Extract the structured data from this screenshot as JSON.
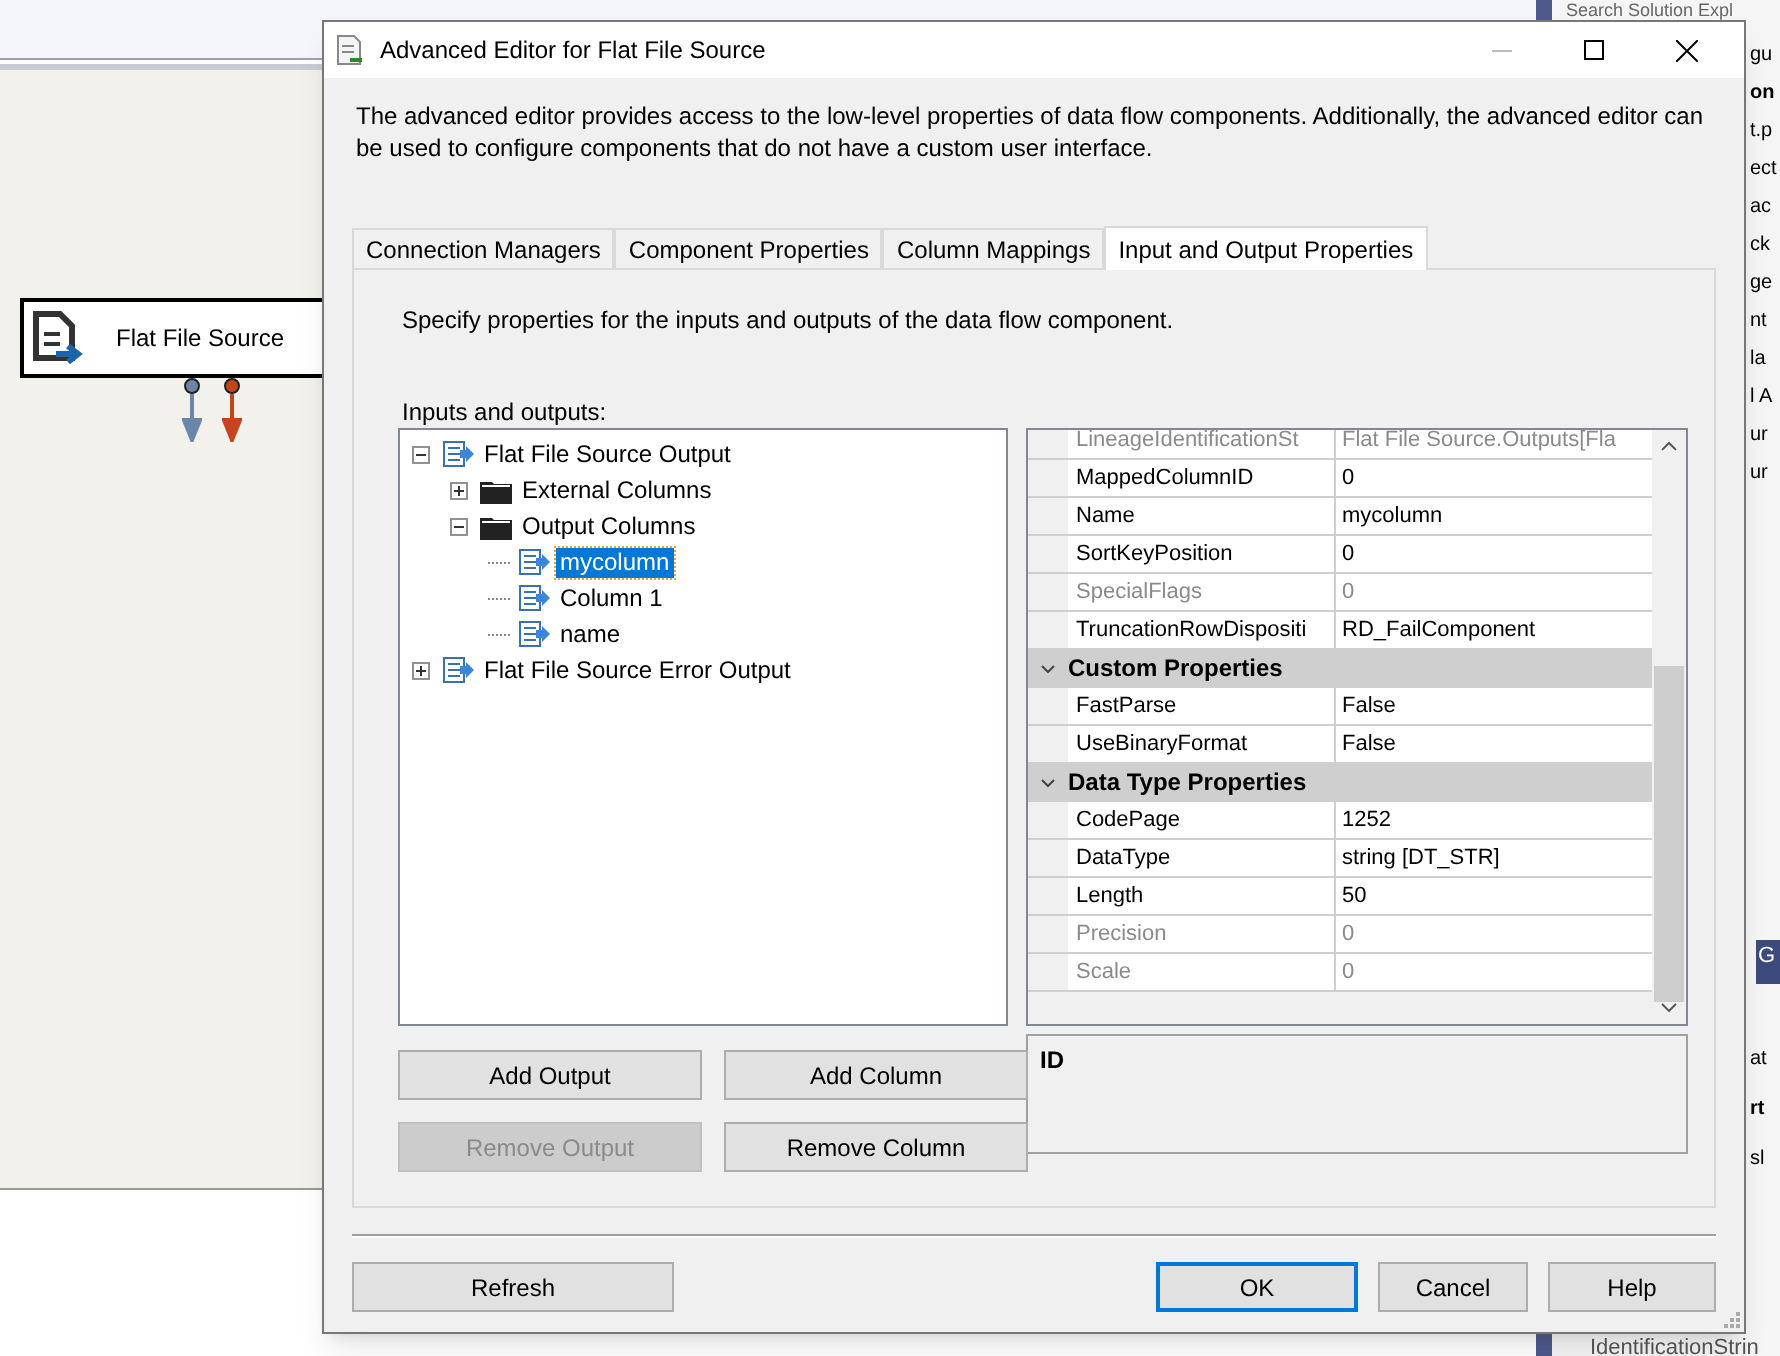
{
  "background": {
    "canvas_component": {
      "label": "Flat File Source"
    },
    "side_panel": {
      "search_text": "Search Solution Expl",
      "fragments": [
        {
          "text": "gu",
          "bold": false
        },
        {
          "text": "on",
          "bold": true
        },
        {
          "text": "t.p",
          "bold": false
        },
        {
          "text": "ect",
          "bold": false
        },
        {
          "text": "ac",
          "bold": false
        },
        {
          "text": "ck",
          "bold": false
        },
        {
          "text": "ge",
          "bold": false
        },
        {
          "text": "nt",
          "bold": false
        },
        {
          "text": "la",
          "bold": false
        },
        {
          "text": "l A",
          "bold": false
        },
        {
          "text": "ur",
          "bold": false
        },
        {
          "text": "ur",
          "bold": false
        }
      ],
      "properties_header": "G",
      "lower_fragments": [
        {
          "text": "at",
          "bold": false
        },
        {
          "text": "rt",
          "bold": true
        },
        {
          "text": "sl",
          "bold": false
        }
      ],
      "bottom_text": "IdentificationStrin"
    }
  },
  "window": {
    "title": "Advanced Editor for Flat File Source"
  },
  "description": "The advanced editor provides access to the low-level properties of data flow components. Additionally, the advanced editor can be used to configure components that do not have a custom user interface.",
  "tabs": [
    {
      "label": "Connection Managers",
      "selected": false
    },
    {
      "label": "Component Properties",
      "selected": false
    },
    {
      "label": "Column Mappings",
      "selected": false
    },
    {
      "label": "Input and Output Properties",
      "selected": true
    }
  ],
  "panel": {
    "instruction": "Specify properties for the inputs and outputs of the data flow component.",
    "tree_label": "Inputs and outputs:",
    "tree": [
      {
        "label": "Flat File Source Output",
        "kind": "output",
        "expanded": true,
        "selected": false,
        "children": [
          {
            "label": "External Columns",
            "kind": "folder",
            "expanded": false,
            "selected": false
          },
          {
            "label": "Output Columns",
            "kind": "folder",
            "expanded": true,
            "selected": false,
            "children": [
              {
                "label": "mycolumn",
                "kind": "column",
                "selected": true
              },
              {
                "label": "Column 1",
                "kind": "column",
                "selected": false
              },
              {
                "label": "name",
                "kind": "column",
                "selected": false
              }
            ]
          }
        ]
      },
      {
        "label": "Flat File Source Error Output",
        "kind": "output",
        "expanded": false,
        "selected": false
      }
    ],
    "properties": [
      {
        "kind": "property",
        "name": "LineageIdentificationSt",
        "value": "Flat File Source.Outputs[Fla",
        "disabled": true
      },
      {
        "kind": "property",
        "name": "MappedColumnID",
        "value": "0",
        "disabled": false
      },
      {
        "kind": "property",
        "name": "Name",
        "value": "mycolumn",
        "disabled": false
      },
      {
        "kind": "property",
        "name": "SortKeyPosition",
        "value": "0",
        "disabled": false
      },
      {
        "kind": "property",
        "name": "SpecialFlags",
        "value": "0",
        "disabled": true
      },
      {
        "kind": "property",
        "name": "TruncationRowDispositi",
        "value": "RD_FailComponent",
        "disabled": false
      },
      {
        "kind": "category",
        "name": "Custom Properties",
        "expanded": true
      },
      {
        "kind": "property",
        "name": "FastParse",
        "value": "False",
        "disabled": false
      },
      {
        "kind": "property",
        "name": "UseBinaryFormat",
        "value": "False",
        "disabled": false
      },
      {
        "kind": "category",
        "name": "Data Type Properties",
        "expanded": true
      },
      {
        "kind": "property",
        "name": "CodePage",
        "value": "1252",
        "disabled": false
      },
      {
        "kind": "property",
        "name": "DataType",
        "value": "string [DT_STR]",
        "disabled": false
      },
      {
        "kind": "property",
        "name": "Length",
        "value": "50",
        "disabled": false
      },
      {
        "kind": "property",
        "name": "Precision",
        "value": "0",
        "disabled": true
      },
      {
        "kind": "property",
        "name": "Scale",
        "value": "0",
        "disabled": true
      }
    ],
    "property_description": "ID",
    "buttons": [
      {
        "label": "Add Output",
        "disabled": false
      },
      {
        "label": "Add Column",
        "disabled": false
      },
      {
        "label": "Remove Output",
        "disabled": true
      },
      {
        "label": "Remove Column",
        "disabled": false
      }
    ]
  },
  "footer_buttons": [
    {
      "label": "Refresh",
      "default": false
    },
    {
      "label": "OK",
      "default": true
    },
    {
      "label": "Cancel",
      "default": false
    },
    {
      "label": "Help",
      "default": false
    }
  ]
}
